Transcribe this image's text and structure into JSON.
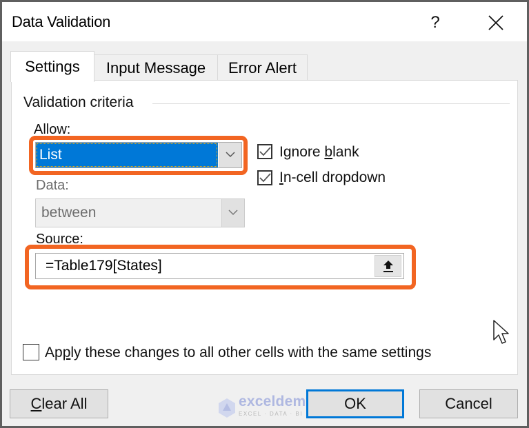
{
  "window": {
    "title": "Data Validation",
    "help_label": "?",
    "close_icon": "close-icon"
  },
  "tabs": [
    {
      "label": "Settings",
      "active": true
    },
    {
      "label": "Input Message",
      "active": false
    },
    {
      "label": "Error Alert",
      "active": false
    }
  ],
  "settings": {
    "group_label": "Validation criteria",
    "allow": {
      "label": "Allow:",
      "value": "List",
      "highlighted": true
    },
    "data": {
      "label": "Data:",
      "value": "between",
      "disabled": true
    },
    "ignore_blank": {
      "label_pre": "Ignore ",
      "label_u": "b",
      "label_post": "lank",
      "checked": true
    },
    "in_cell_dropdown": {
      "label_u": "I",
      "label_post": "n-cell dropdown",
      "checked": true
    },
    "source": {
      "label": "Source:",
      "value": "=Table179[States]",
      "collapse_icon": "upload-arrow-icon",
      "highlighted": true
    },
    "apply_all": {
      "label_pre": "Ap",
      "label_u": "p",
      "label_post": "ly these changes to all other cells with the same settings",
      "checked": false
    }
  },
  "buttons": {
    "clear_all_u": "C",
    "clear_all_rest": "lear All",
    "ok": "OK",
    "cancel": "Cancel"
  },
  "watermark": {
    "brand": "exceldemy",
    "tagline": "EXCEL · DATA · BI"
  },
  "colors": {
    "highlight": "#f26522",
    "selection": "#0078d7",
    "default_button_border": "#0078d7"
  }
}
